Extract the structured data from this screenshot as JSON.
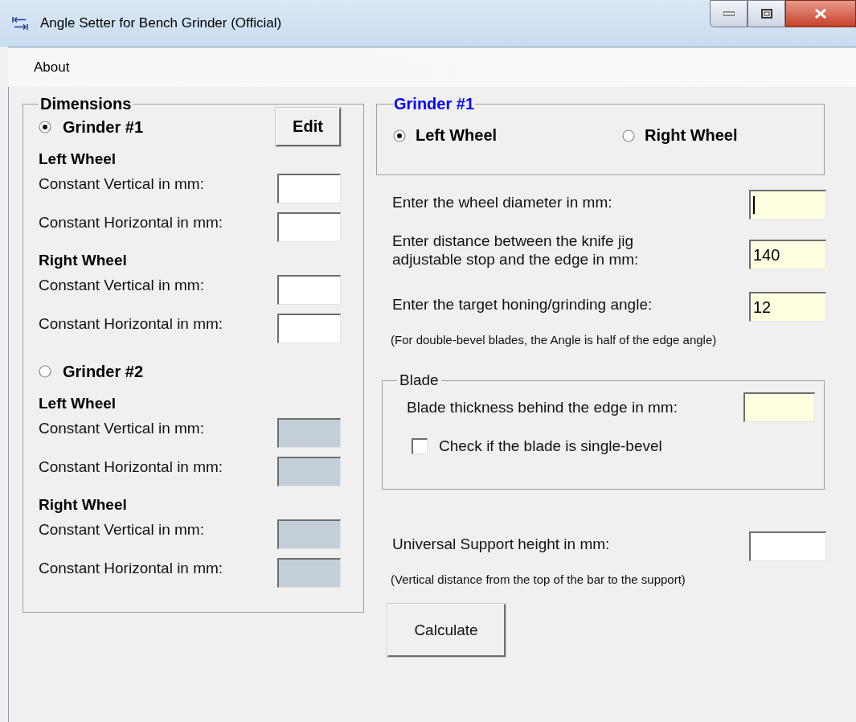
{
  "window": {
    "title": "Angle Setter for Bench Grinder (Official)"
  },
  "menu": [
    {
      "label": "About"
    }
  ],
  "dimensions": {
    "title": "Dimensions",
    "edit_button": "Edit",
    "grinders": [
      {
        "label": "Grinder #1",
        "selected": true,
        "wheels": [
          {
            "heading": "Left Wheel",
            "fields": [
              {
                "label": "Constant Vertical in mm:",
                "disabled": false
              },
              {
                "label": "Constant Horizontal in mm:",
                "disabled": false
              }
            ]
          },
          {
            "heading": "Right Wheel",
            "fields": [
              {
                "label": "Constant Vertical in mm:",
                "disabled": false
              },
              {
                "label": "Constant Horizontal in mm:",
                "disabled": false
              }
            ]
          }
        ]
      },
      {
        "label": "Grinder #2",
        "selected": false,
        "wheels": [
          {
            "heading": "Left Wheel",
            "fields": [
              {
                "label": "Constant Vertical in mm:",
                "disabled": true
              },
              {
                "label": "Constant Horizontal in mm:",
                "disabled": true
              }
            ]
          },
          {
            "heading": "Right Wheel",
            "fields": [
              {
                "label": "Constant Vertical in mm:",
                "disabled": true
              },
              {
                "label": "Constant Horizontal in mm:",
                "disabled": true
              }
            ]
          }
        ]
      }
    ]
  },
  "grinder_panel": {
    "title": "Grinder #1",
    "wheels": [
      {
        "label": "Left Wheel",
        "selected": true
      },
      {
        "label": "Right Wheel",
        "selected": false
      }
    ]
  },
  "inputs": [
    {
      "label": "Enter the wheel diameter in mm:",
      "highlighted": true,
      "focused": true
    },
    {
      "label": "Enter distance between the knife jig adjustable stop and the edge in mm:",
      "value": "140",
      "highlighted": true,
      "focused": false
    },
    {
      "label": "Enter the target honing/grinding angle:",
      "value": "12",
      "highlighted": true,
      "focused": false
    }
  ],
  "angle_note": "(For double-bevel blades, the Angle is half of the edge angle)",
  "blade": {
    "title": "Blade",
    "thickness": {
      "label": "Blade thickness behind the edge in mm:",
      "highlighted": true
    },
    "single_bevel": {
      "label": "Check if the blade is single-bevel",
      "checked": false
    }
  },
  "support": {
    "label": "Universal Support height in mm:",
    "highlighted": false,
    "note": "(Vertical distance from the top of the bar to the support)"
  },
  "calculate_button": "Calculate"
}
